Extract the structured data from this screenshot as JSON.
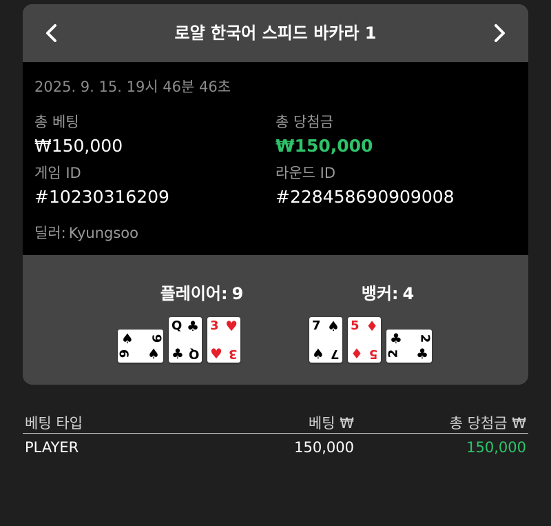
{
  "header": {
    "title": "로얄 한국어 스피드 바카라 1",
    "prev_icon": "chevron-left-icon",
    "next_icon": "chevron-right-icon"
  },
  "info": {
    "timestamp": "2025. 9. 15. 19시 46분 46초",
    "total_bet_label": "총 베팅",
    "total_bet_value": "₩150,000",
    "total_win_label": "총 당첨금",
    "total_win_value": "₩150,000",
    "game_id_label": "게임 ID",
    "game_id_value": "#10230316209",
    "round_id_label": "라운드 ID",
    "round_id_value": "#228458690909008",
    "dealer_label": "딜러:",
    "dealer_name": "Kyungsoo"
  },
  "result": {
    "player": {
      "label": "플레이어:",
      "score": "9",
      "cards": [
        {
          "rank": "9",
          "suit": "♠",
          "color": "black"
        },
        {
          "rank": "Q",
          "suit": "♣",
          "color": "black"
        },
        {
          "rank": "3",
          "suit": "♥",
          "color": "red"
        }
      ]
    },
    "banker": {
      "label": "뱅커:",
      "score": "4",
      "cards": [
        {
          "rank": "7",
          "suit": "♠",
          "color": "black"
        },
        {
          "rank": "5",
          "suit": "♦",
          "color": "red"
        },
        {
          "rank": "2",
          "suit": "♣",
          "color": "black"
        }
      ]
    }
  },
  "bets_table": {
    "columns": [
      "베팅 타입",
      "베팅 ₩",
      "총 당첨금 ₩"
    ],
    "rows": [
      {
        "type": "PLAYER",
        "bet": "150,000",
        "win": "150,000"
      }
    ]
  },
  "colors": {
    "win_green": "#2ec36a",
    "card_red": "#e5202a",
    "panel_bg": "#454545",
    "info_bg": "#000000",
    "page_bg": "#1f1f1f"
  }
}
